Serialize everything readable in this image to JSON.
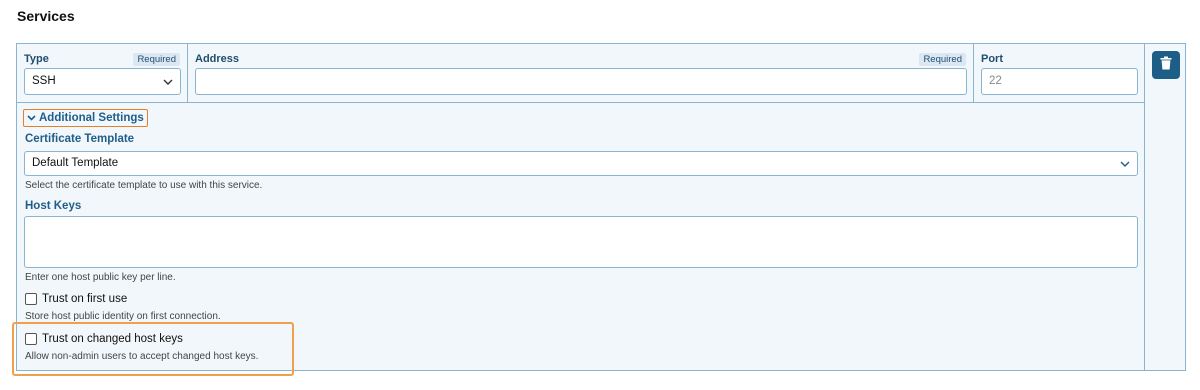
{
  "section": {
    "title": "Services"
  },
  "fields": {
    "type": {
      "label": "Type",
      "required": "Required",
      "value": "SSH"
    },
    "address": {
      "label": "Address",
      "required": "Required",
      "value": ""
    },
    "port": {
      "label": "Port",
      "placeholder": "22"
    }
  },
  "additional_settings": {
    "toggle_label": "Additional Settings",
    "certificate_template": {
      "label": "Certificate Template",
      "value": "Default Template",
      "help": "Select the certificate template to use with this service."
    },
    "host_keys": {
      "label": "Host Keys",
      "value": "",
      "help": "Enter one host public key per line."
    },
    "trust_first_use": {
      "label": "Trust on first use",
      "checked": false,
      "help": "Store host public identity on first connection."
    },
    "trust_changed_keys": {
      "label": "Trust on changed host keys",
      "checked": false,
      "help": "Allow non-admin users to accept changed host keys."
    }
  },
  "actions": {
    "delete_icon": "trash-icon"
  },
  "colors": {
    "accent": "#1c5e86",
    "border": "#8ab4d0",
    "highlight": "#f0a04a"
  }
}
